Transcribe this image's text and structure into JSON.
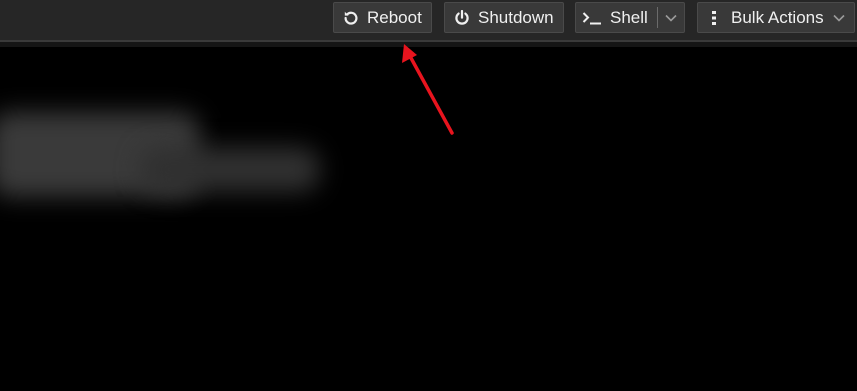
{
  "toolbar": {
    "reboot_label": "Reboot",
    "shutdown_label": "Shutdown",
    "shell_label": "Shell",
    "bulk_actions_label": "Bulk Actions"
  },
  "icons": {
    "reboot": "reboot-icon",
    "shutdown": "power-icon",
    "shell": "terminal-icon",
    "shell_dropdown": "chevron-down-icon",
    "bulk_actions": "vertical-dots-icon",
    "bulk_dropdown": "chevron-down-icon"
  },
  "colors": {
    "toolbar_background": "#262626",
    "button_background": "#393939",
    "button_text": "#f0f0f0",
    "content_background": "#000000",
    "annotation_arrow": "#e8141e"
  }
}
